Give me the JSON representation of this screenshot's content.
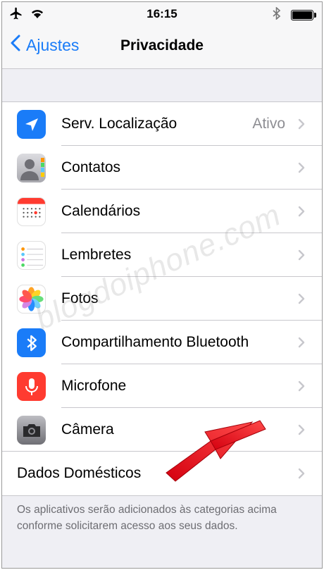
{
  "status_bar": {
    "time": "16:15"
  },
  "nav": {
    "back_label": "Ajustes",
    "title": "Privacidade"
  },
  "rows": [
    {
      "label": "Serv. Localização",
      "value": "Ativo",
      "icon": "location-arrow-icon",
      "color": "#1a7cf8"
    },
    {
      "label": "Contatos",
      "icon": "contacts-icon",
      "color": "#9a9aa0"
    },
    {
      "label": "Calendários",
      "icon": "calendar-icon",
      "color": "#ff3b30"
    },
    {
      "label": "Lembretes",
      "icon": "reminders-icon",
      "color": "#ffffff"
    },
    {
      "label": "Fotos",
      "icon": "photos-icon",
      "color": "#ffffff"
    },
    {
      "label": "Compartilhamento Bluetooth",
      "icon": "bluetooth-icon",
      "color": "#1a7cf8"
    },
    {
      "label": "Microfone",
      "icon": "microphone-icon",
      "color": "#ff3b30"
    },
    {
      "label": "Câmera",
      "icon": "camera-icon",
      "color": "#8e8e93"
    },
    {
      "label": "Dados Domésticos"
    }
  ],
  "footer": "Os aplicativos serão adicionados às categorias acima conforme solicitarem acesso aos seus dados.",
  "watermark": "blogdoiphone.com",
  "colors": {
    "accent": "#1a7cf8",
    "annotation_arrow": "#e8101a"
  }
}
